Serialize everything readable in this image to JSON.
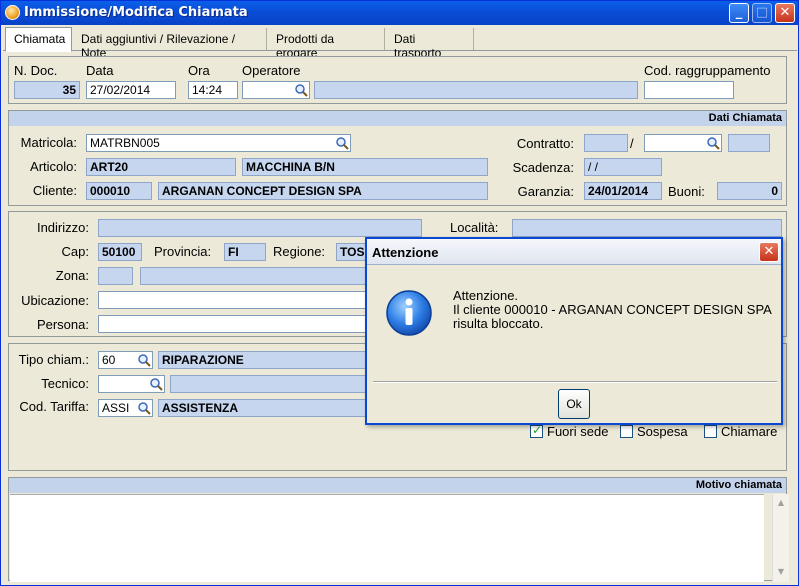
{
  "window": {
    "title": "Immissione/Modifica Chiamata"
  },
  "titlebar": {
    "minimize": "_",
    "maximize": "□",
    "close": "✕"
  },
  "tabs": [
    {
      "label": "Chiamata",
      "active": true
    },
    {
      "label": "Dati aggiuntivi / Rilevazione / Note"
    },
    {
      "label": "Prodotti da erogare"
    },
    {
      "label": "Dati trasporto"
    }
  ],
  "doc": {
    "ndoc_label": "N. Doc.",
    "ndoc": "35",
    "data_label": "Data",
    "data": "27/02/2014",
    "ora_label": "Ora",
    "ora": "14:24",
    "operatore_label": "Operatore",
    "operatore": "",
    "operatore_desc": "",
    "cod_raggr_label": "Cod. raggruppamento",
    "cod_raggr": ""
  },
  "dati_chiamata": {
    "header": "Dati Chiamata",
    "matricola_label": "Matricola:",
    "matricola": "MATRBN005",
    "articolo_label": "Articolo:",
    "articolo_code": "ART20",
    "articolo_desc": "MACCHINA B/N",
    "cliente_label": "Cliente:",
    "cliente_code": "000010",
    "cliente_desc": "ARGANAN CONCEPT DESIGN SPA",
    "contratto_label": "Contratto:",
    "contratto_1": "",
    "contratto_sep": "/",
    "contratto_2": "",
    "contratto_3": "",
    "scadenza_label": "Scadenza:",
    "scadenza": "/ /",
    "garanzia_label": "Garanzia:",
    "garanzia": "24/01/2014",
    "buoni_label": "Buoni:",
    "buoni": "0"
  },
  "indirizzo": {
    "indirizzo_label": "Indirizzo:",
    "indirizzo": "",
    "localita_label": "Località:",
    "localita": "",
    "cap_label": "Cap:",
    "cap": "50100",
    "provincia_label": "Provincia:",
    "provincia": "FI",
    "regione_label": "Regione:",
    "regione": "TOSC",
    "zona_label": "Zona:",
    "zona_code": "",
    "zona_desc": "",
    "ubicazione_label": "Ubicazione:",
    "ubicazione": "",
    "persona_label": "Persona:",
    "persona": ""
  },
  "tipo": {
    "tipo_label": "Tipo chiam.:",
    "tipo_code": "60",
    "tipo_desc": "RIPARAZIONE",
    "tecnico_label": "Tecnico:",
    "tecnico_code": "",
    "tecnico_desc": "",
    "tariffa_label": "Cod. Tariffa:",
    "tariffa_code": "ASSI",
    "tariffa_desc": "ASSISTENZA",
    "fuori_sede_label": "Fuori sede",
    "fuori_sede": true,
    "sospesa_label": "Sospesa",
    "sospesa": false,
    "chiamare_label": "Chiamare",
    "chiamare": false
  },
  "motivo": {
    "header": "Motivo chiamata",
    "text": ""
  },
  "dialog": {
    "title": "Attenzione",
    "line1": "Attenzione.",
    "line2": "Il cliente 000010 - ARGANAN CONCEPT DESIGN SPA",
    "line3": "risulta bloccato.",
    "ok_label": "Ok",
    "close": "✕"
  },
  "icons": {
    "app": "app-icon",
    "lookup": "magnifier-icon",
    "info": "info-icon"
  }
}
